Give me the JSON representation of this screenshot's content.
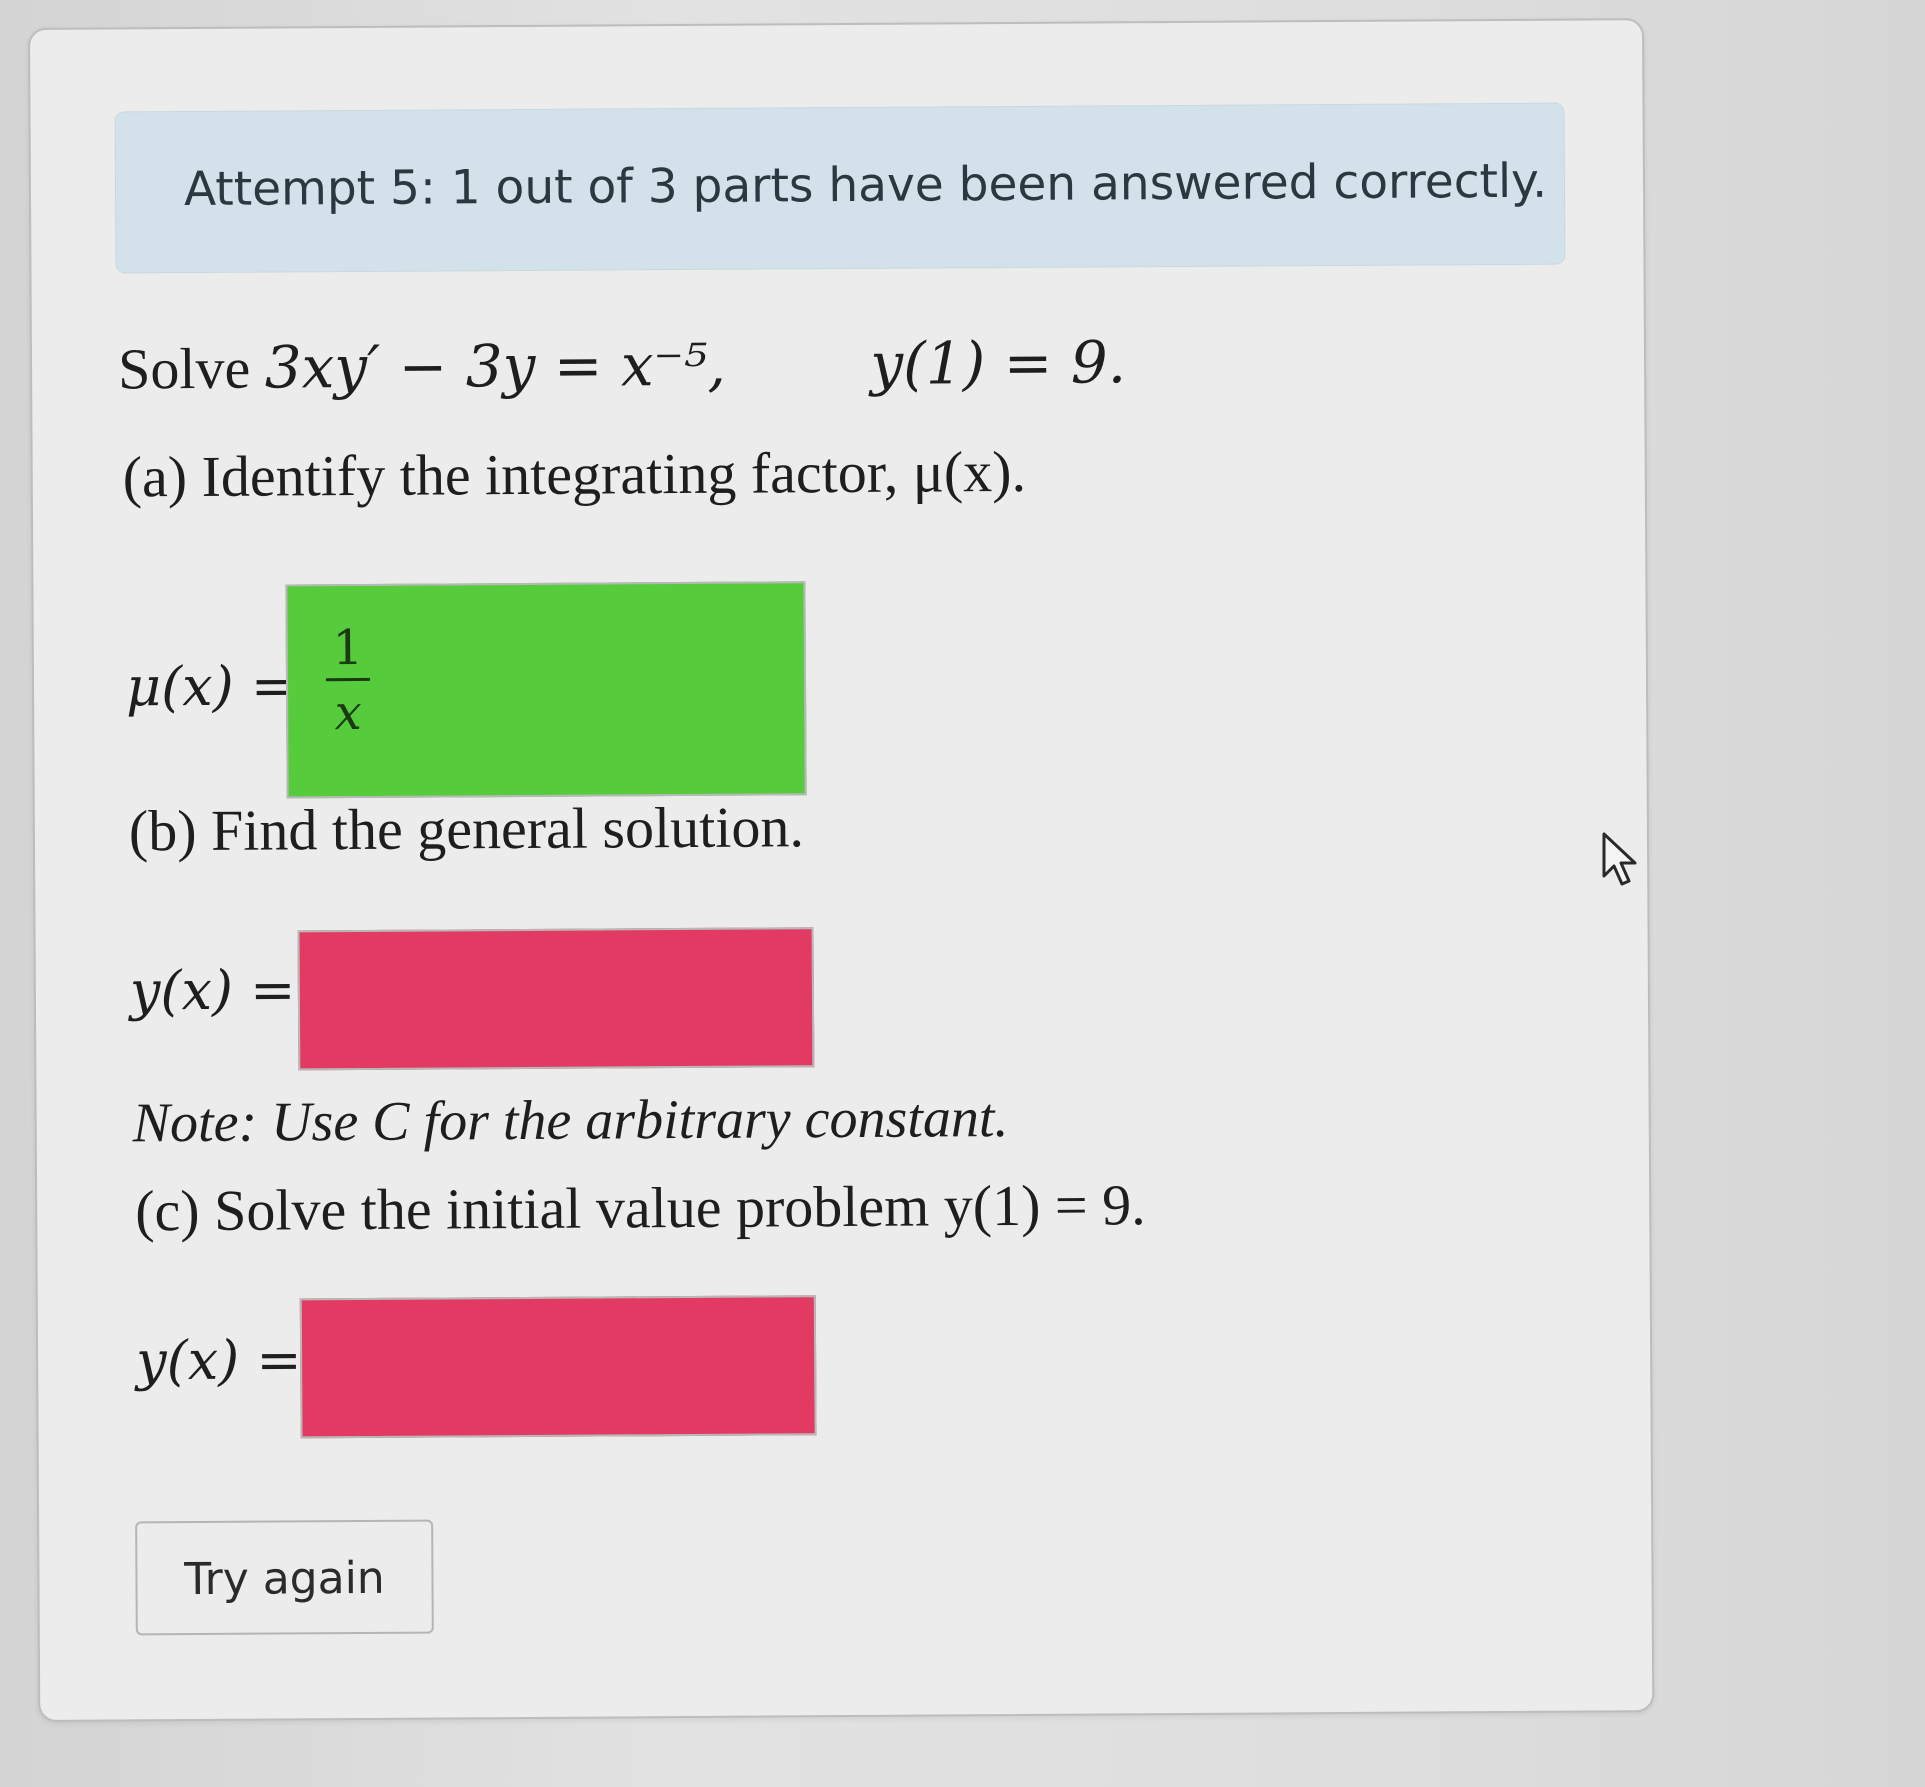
{
  "status": {
    "text": "Attempt 5: 1 out of 3 parts have been answered correctly."
  },
  "problem": {
    "prefix": "Solve",
    "equation": "3xy′ − 3y = x⁻⁵,",
    "initial_condition": "y(1) = 9."
  },
  "part_a": {
    "prompt": "(a) Identify the integrating factor, μ(x).",
    "lhs": "μ(x) =",
    "answer_numerator": "1",
    "answer_denominator": "x",
    "status_color": "#56cc3c"
  },
  "part_b": {
    "prompt": "(b) Find the general solution.",
    "lhs": "y(x) =",
    "answer_value": "",
    "status_color": "#e23a62",
    "note": "Note: Use C for the arbitrary constant."
  },
  "part_c": {
    "prompt": "(c) Solve the initial value problem y(1) = 9.",
    "lhs": "y(x) =",
    "answer_value": "",
    "status_color": "#e23a62"
  },
  "actions": {
    "try_again_label": "Try again"
  },
  "icons": {
    "cursor": "mouse-pointer-icon"
  }
}
